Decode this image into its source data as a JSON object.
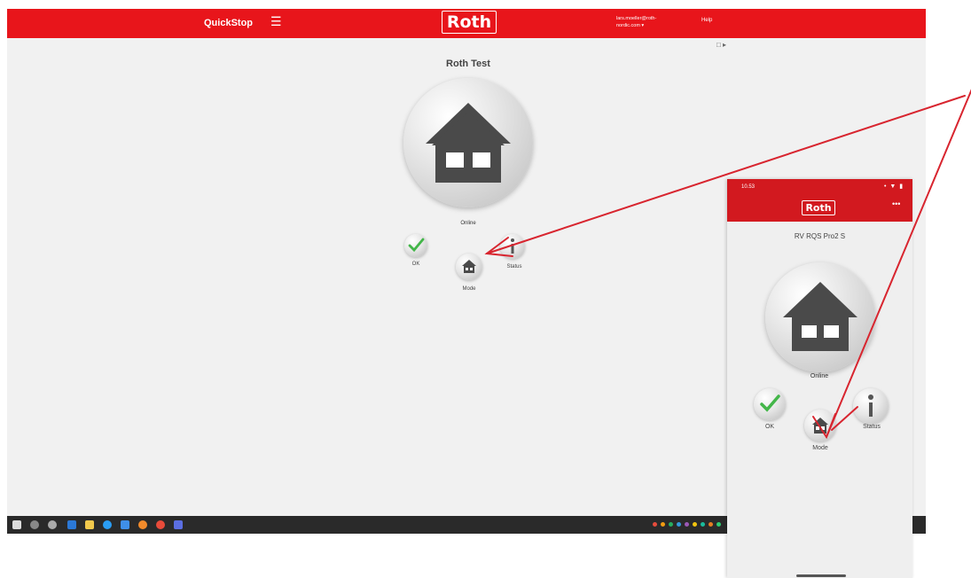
{
  "desktop": {
    "app_name": "QuickStop",
    "menu_icon": "hamburger-icon",
    "brand": "Roth",
    "account": "lars.moeller@roth-nordic.com ▾",
    "help": "Help",
    "toolbar_icon": "tablet-icon",
    "toolbar_icon_text": "□ ▸",
    "device_title": "Roth Test",
    "status_text": "Online",
    "ok_label": "OK",
    "mode_label": "Mode",
    "status_label": "Status"
  },
  "phone": {
    "time": "10.53",
    "status_icons": "• ▼ ▮",
    "brand": "Roth",
    "more_icon": "•••",
    "device_title": "RV RQS Pro2 S",
    "status_text": "Online",
    "ok_label": "OK",
    "mode_label": "Mode",
    "status_label": "Status"
  },
  "colors": {
    "brand_red": "#e8151b",
    "phone_red": "#d2191f",
    "annotation_red": "#d8252f",
    "ok_green": "#43b649",
    "house_gray": "#4a4a4a"
  }
}
